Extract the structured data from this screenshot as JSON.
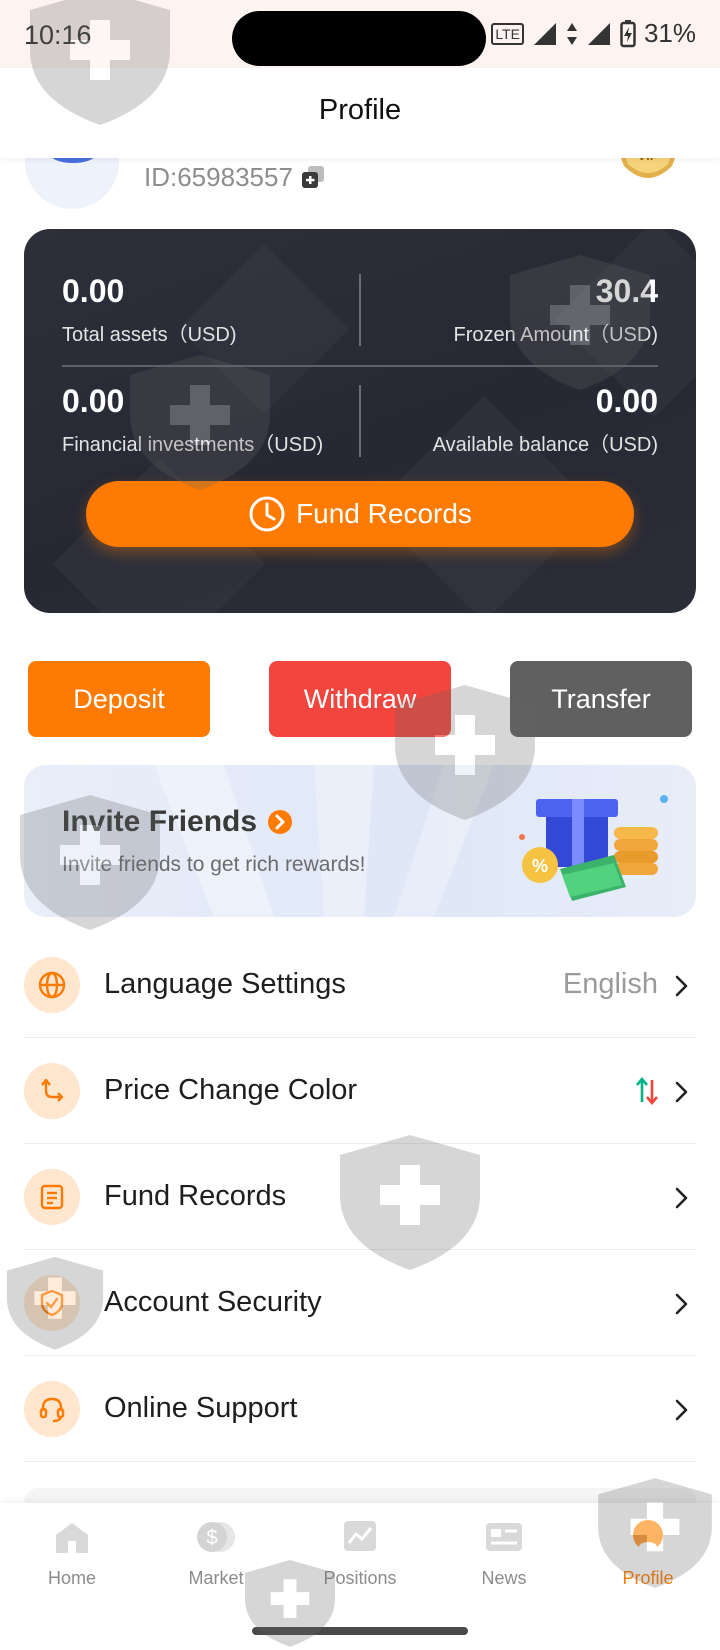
{
  "status_bar": {
    "time": "10:16",
    "battery": "31%",
    "network": "LTE"
  },
  "header": {
    "title": "Profile"
  },
  "profile": {
    "user_id": "ID:65983557",
    "badge": "VIP"
  },
  "assets": {
    "total_assets_value": "0.00",
    "total_assets_label": "Total assets（USD)",
    "frozen_value": "30.4",
    "frozen_label": "Frozen Amount（USD)",
    "financial_value": "0.00",
    "financial_label": "Financial investments（USD)",
    "available_value": "0.00",
    "available_label": "Available balance（USD)",
    "fund_records_button": "Fund Records"
  },
  "actions": {
    "deposit": "Deposit",
    "withdraw": "Withdraw",
    "transfer": "Transfer"
  },
  "invite": {
    "title": "Invite Friends",
    "subtitle": "Invite friends to get rich rewards!"
  },
  "menu": [
    {
      "label": "Language Settings",
      "value": "English",
      "icon": "globe-icon"
    },
    {
      "label": "Price Change Color",
      "value": "",
      "icon": "swap-arrows-icon"
    },
    {
      "label": "Fund Records",
      "value": "",
      "icon": "document-icon"
    },
    {
      "label": "Account Security",
      "value": "",
      "icon": "shield-check-icon"
    },
    {
      "label": "Online Support",
      "value": "",
      "icon": "headset-icon"
    }
  ],
  "nav": [
    {
      "label": "Home",
      "icon": "home-icon"
    },
    {
      "label": "Market",
      "icon": "dollar-coin-icon"
    },
    {
      "label": "Positions",
      "icon": "chart-icon"
    },
    {
      "label": "News",
      "icon": "newspaper-icon"
    },
    {
      "label": "Profile",
      "icon": "profile-icon"
    }
  ],
  "colors": {
    "accent": "#ff7a00",
    "withdraw": "#f2453d",
    "transfer": "#606060",
    "card": "#2b2d38",
    "up": "#00b386",
    "down": "#f2453d"
  }
}
